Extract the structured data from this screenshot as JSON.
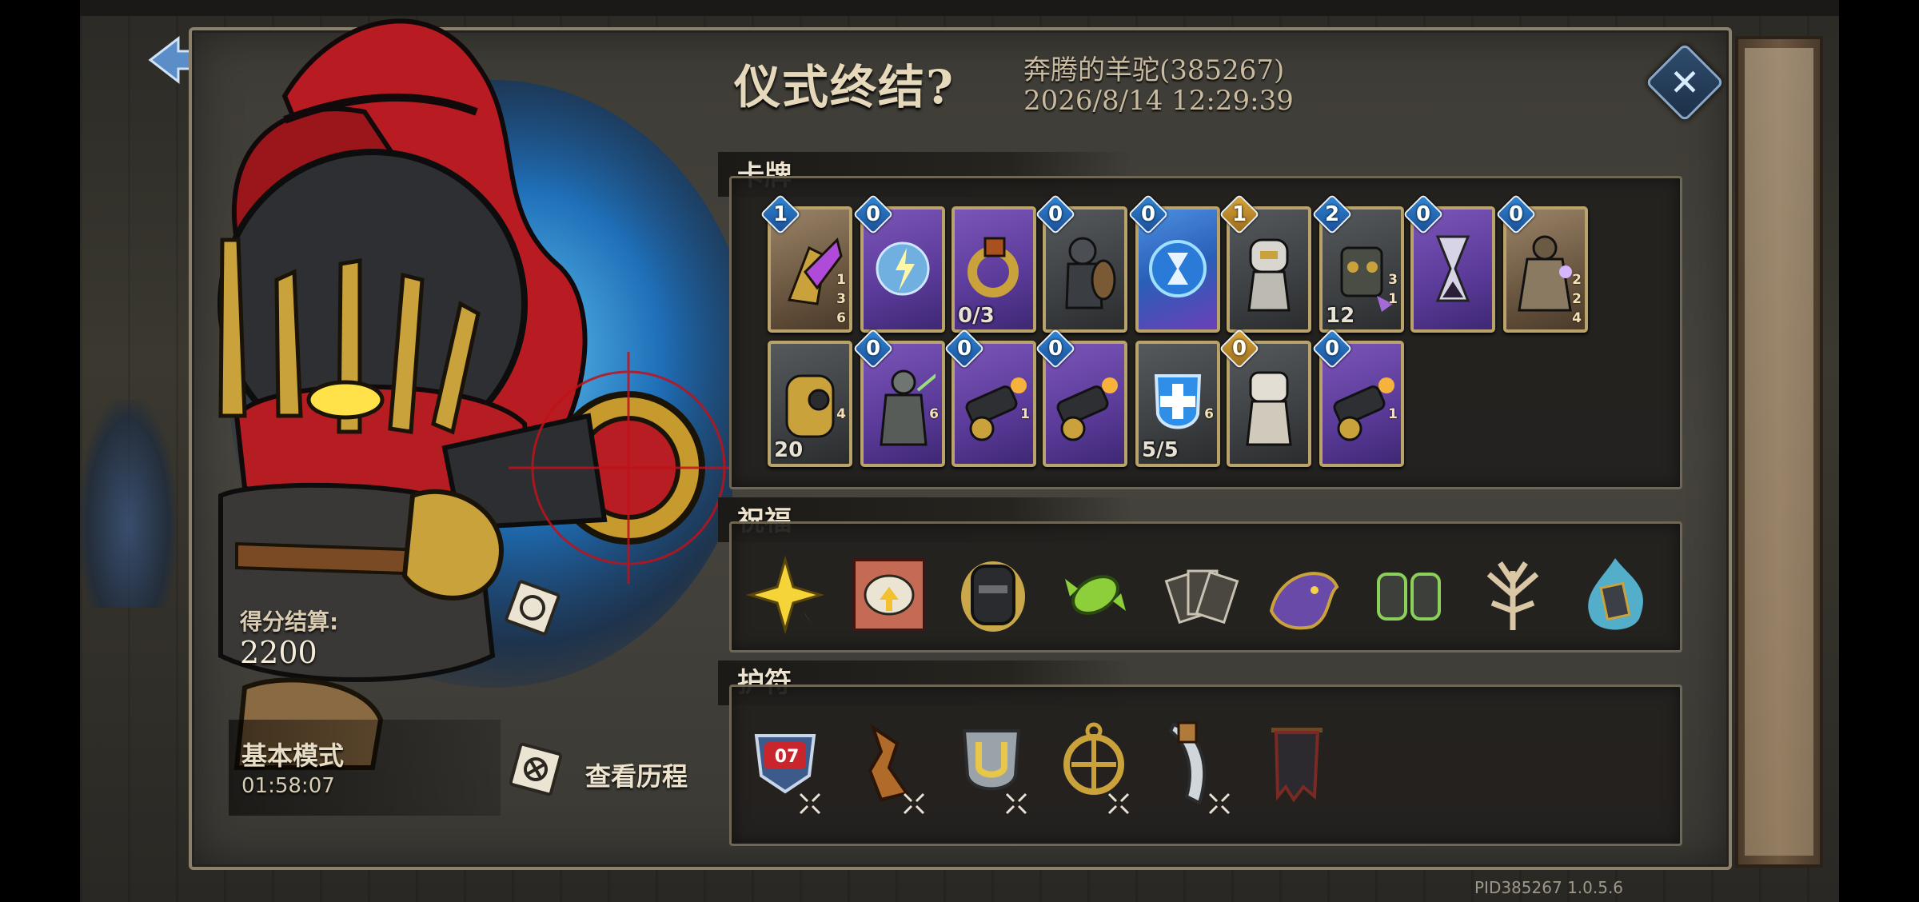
{
  "dialog": {
    "title": "仪式终结?",
    "player_name": "奔腾的羊驼(385267)",
    "datetime": "2026/8/14 12:29:39"
  },
  "score": {
    "label": "得分结算:",
    "value": "2200"
  },
  "mode": {
    "name": "基本模式",
    "time": "01:58:07"
  },
  "history_button": {
    "label": "查看历程"
  },
  "sections": {
    "cards": "卡牌",
    "blessings": "祝福",
    "amulets": "护符"
  },
  "cards": [
    {
      "cost": "1",
      "cost_color": "blue",
      "frame": "brown",
      "art": "gauntlet-icon",
      "counter": "",
      "small": [
        "1",
        "3",
        "6"
      ]
    },
    {
      "cost": "0",
      "cost_color": "blue",
      "frame": "purple",
      "art": "lightning-orb-icon",
      "counter": "",
      "small": []
    },
    {
      "cost": "",
      "cost_color": "",
      "frame": "purple",
      "art": "brass-ring-icon",
      "counter": "0/3",
      "small": []
    },
    {
      "cost": "0",
      "cost_color": "blue",
      "frame": "grey",
      "art": "knight-shield-icon",
      "counter": "",
      "small": []
    },
    {
      "cost": "0",
      "cost_color": "blue",
      "frame": "blue",
      "art": "hourglass-orb-icon",
      "counter": "",
      "small": []
    },
    {
      "cost": "1",
      "cost_color": "gold",
      "frame": "grey",
      "art": "robot-icon",
      "counter": "",
      "small": []
    },
    {
      "cost": "2",
      "cost_color": "blue",
      "frame": "grey",
      "art": "mech-golem-icon",
      "counter": "12",
      "small": [
        "3",
        "1"
      ]
    },
    {
      "cost": "0",
      "cost_color": "blue",
      "frame": "purple",
      "art": "hourglass-icon",
      "counter": "",
      "small": []
    },
    {
      "cost": "0",
      "cost_color": "blue",
      "frame": "brown",
      "art": "robed-mage-icon",
      "counter": "",
      "small": [
        "2",
        "2",
        "4"
      ]
    },
    {
      "cost": "",
      "cost_color": "",
      "frame": "grey",
      "art": "gold-golem-icon",
      "counter": "20",
      "small": [
        "4"
      ]
    },
    {
      "cost": "0",
      "cost_color": "blue",
      "frame": "purple",
      "art": "armored-warrior-icon",
      "counter": "",
      "small": [
        "6"
      ]
    },
    {
      "cost": "0",
      "cost_color": "blue",
      "frame": "purple",
      "art": "cannon-icon",
      "counter": "",
      "small": [
        "1"
      ]
    },
    {
      "cost": "0",
      "cost_color": "blue",
      "frame": "purple",
      "art": "cannon-icon",
      "counter": "",
      "small": []
    },
    {
      "cost": "",
      "cost_color": "",
      "frame": "grey",
      "art": "cross-shield-icon",
      "counter": "5/5",
      "small": [
        "6"
      ]
    },
    {
      "cost": "0",
      "cost_color": "gold",
      "frame": "grey",
      "art": "white-mech-icon",
      "counter": "",
      "small": []
    },
    {
      "cost": "0",
      "cost_color": "blue",
      "frame": "purple",
      "art": "cannon-icon",
      "counter": "",
      "small": [
        "1"
      ]
    }
  ],
  "blessings": [
    {
      "icon": "sparkle-star-icon",
      "color": "#f5d43a"
    },
    {
      "icon": "brain-upgrade-icon",
      "color": "#c56b55"
    },
    {
      "icon": "dark-helmet-icon",
      "color": "#c9a74a"
    },
    {
      "icon": "green-candy-icon",
      "color": "#8ccf3a"
    },
    {
      "icon": "card-fan-icon",
      "color": "#c9c2b2"
    },
    {
      "icon": "shadow-beast-icon",
      "color": "#6a4aa8"
    },
    {
      "icon": "twin-gauntlets-icon",
      "color": "#8ad05a"
    },
    {
      "icon": "thorn-tree-icon",
      "color": "#d9c7a6"
    },
    {
      "icon": "blue-flame-card-icon",
      "color": "#5cc7e8"
    }
  ],
  "amulets": [
    {
      "icon": "badge-07-icon",
      "badge_text": "07"
    },
    {
      "icon": "broken-sword-icon",
      "badge_text": ""
    },
    {
      "icon": "silver-shield-icon",
      "badge_text": ""
    },
    {
      "icon": "gold-compass-icon",
      "badge_text": ""
    },
    {
      "icon": "claw-blade-icon",
      "badge_text": ""
    },
    {
      "icon": "tattered-banner-icon",
      "badge_text": ""
    }
  ],
  "footer": "PID385267  1.0.5.6"
}
